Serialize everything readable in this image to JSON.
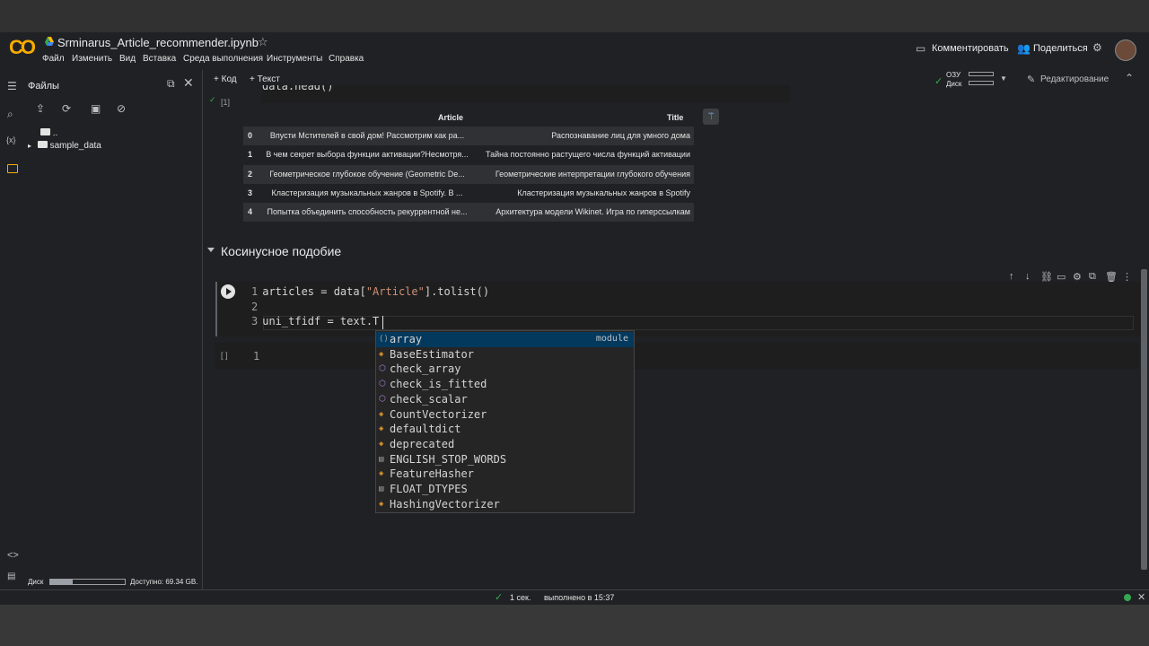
{
  "header": {
    "notebook_title": "Srminarus_Article_recommender.ipynb",
    "menu": [
      "Файл",
      "Изменить",
      "Вид",
      "Вставка",
      "Среда выполнения",
      "Инструменты",
      "Справка"
    ],
    "comment_label": "Комментировать",
    "share_label": "Поделиться"
  },
  "sidebar": {
    "title": "Файлы",
    "tree": [
      "..",
      "sample_data"
    ],
    "disk_label": "Диск",
    "disk_free": "Доступно: 69.34 GB.",
    "disk_used_fraction": 0.3
  },
  "toolbar": {
    "code_label": "Код",
    "text_label": "Текст",
    "ram_label": "ОЗУ",
    "disk_label": "Диск",
    "edit_label": "Редактирование"
  },
  "prev_cell": {
    "counter": "[1]",
    "code_fragment": "data.head()"
  },
  "table": {
    "headers": [
      "Article",
      "Title"
    ],
    "rows": [
      {
        "idx": "0",
        "article": "Впусти Мстителей в свой дом! Рассмотрим как ра...",
        "title": "Распознавание лиц для умного дома"
      },
      {
        "idx": "1",
        "article": "В чем секрет выбора функции активации?Несмотря...",
        "title": "Тайна постоянно растущего числа функций активации"
      },
      {
        "idx": "2",
        "article": "Геометрическое глубокое обучение (Geometric De...",
        "title": "Геометрические интерпретации глубокого обучения"
      },
      {
        "idx": "3",
        "article": "Кластеризация музыкальных жанров в Spotify. В ...",
        "title": "Кластеризация музыкальных жанров в Spotify"
      },
      {
        "idx": "4",
        "article": "Попытка объединить способность рекуррентной не...",
        "title": "Архитектура модели Wikinet. Игра по гиперссылкам"
      }
    ]
  },
  "section": {
    "title": "Косинусное подобие"
  },
  "cell1": {
    "lines": [
      {
        "no": "1",
        "pre": "articles = data[",
        "str": "\"Article\"",
        "post": "].tolist()"
      },
      {
        "no": "2",
        "pre": "",
        "str": "",
        "post": ""
      },
      {
        "no": "3",
        "pre": "uni_tfidf = text.T",
        "str": "",
        "post": ""
      }
    ]
  },
  "cell2": {
    "counter": "[ ]",
    "line_no": "1"
  },
  "autocomplete": {
    "items": [
      {
        "icon": "()",
        "kind_icon": "module-icon",
        "label": "array",
        "detail": "module",
        "selected": true
      },
      {
        "icon": "◈",
        "kind_icon": "class-icon",
        "label": "BaseEstimator",
        "detail": ""
      },
      {
        "icon": "⬡",
        "kind_icon": "function-icon",
        "label": "check_array",
        "detail": ""
      },
      {
        "icon": "⬡",
        "kind_icon": "function-icon",
        "label": "check_is_fitted",
        "detail": ""
      },
      {
        "icon": "⬡",
        "kind_icon": "function-icon",
        "label": "check_scalar",
        "detail": ""
      },
      {
        "icon": "◈",
        "kind_icon": "class-icon",
        "label": "CountVectorizer",
        "detail": ""
      },
      {
        "icon": "◈",
        "kind_icon": "class-icon",
        "label": "defaultdict",
        "detail": ""
      },
      {
        "icon": "◈",
        "kind_icon": "class-icon",
        "label": "deprecated",
        "detail": ""
      },
      {
        "icon": "▤",
        "kind_icon": "constant-icon",
        "label": "ENGLISH_STOP_WORDS",
        "detail": ""
      },
      {
        "icon": "◈",
        "kind_icon": "class-icon",
        "label": "FeatureHasher",
        "detail": ""
      },
      {
        "icon": "▤",
        "kind_icon": "constant-icon",
        "label": "FLOAT_DTYPES",
        "detail": ""
      },
      {
        "icon": "◈",
        "kind_icon": "class-icon",
        "label": "HashingVectorizer",
        "detail": ""
      }
    ]
  },
  "status": {
    "duration": "1 сек.",
    "completed": "выполнено в 15:37"
  },
  "colors": {
    "accent": "#f9ab00",
    "ok_green": "#34a853",
    "selection": "#04395e"
  }
}
